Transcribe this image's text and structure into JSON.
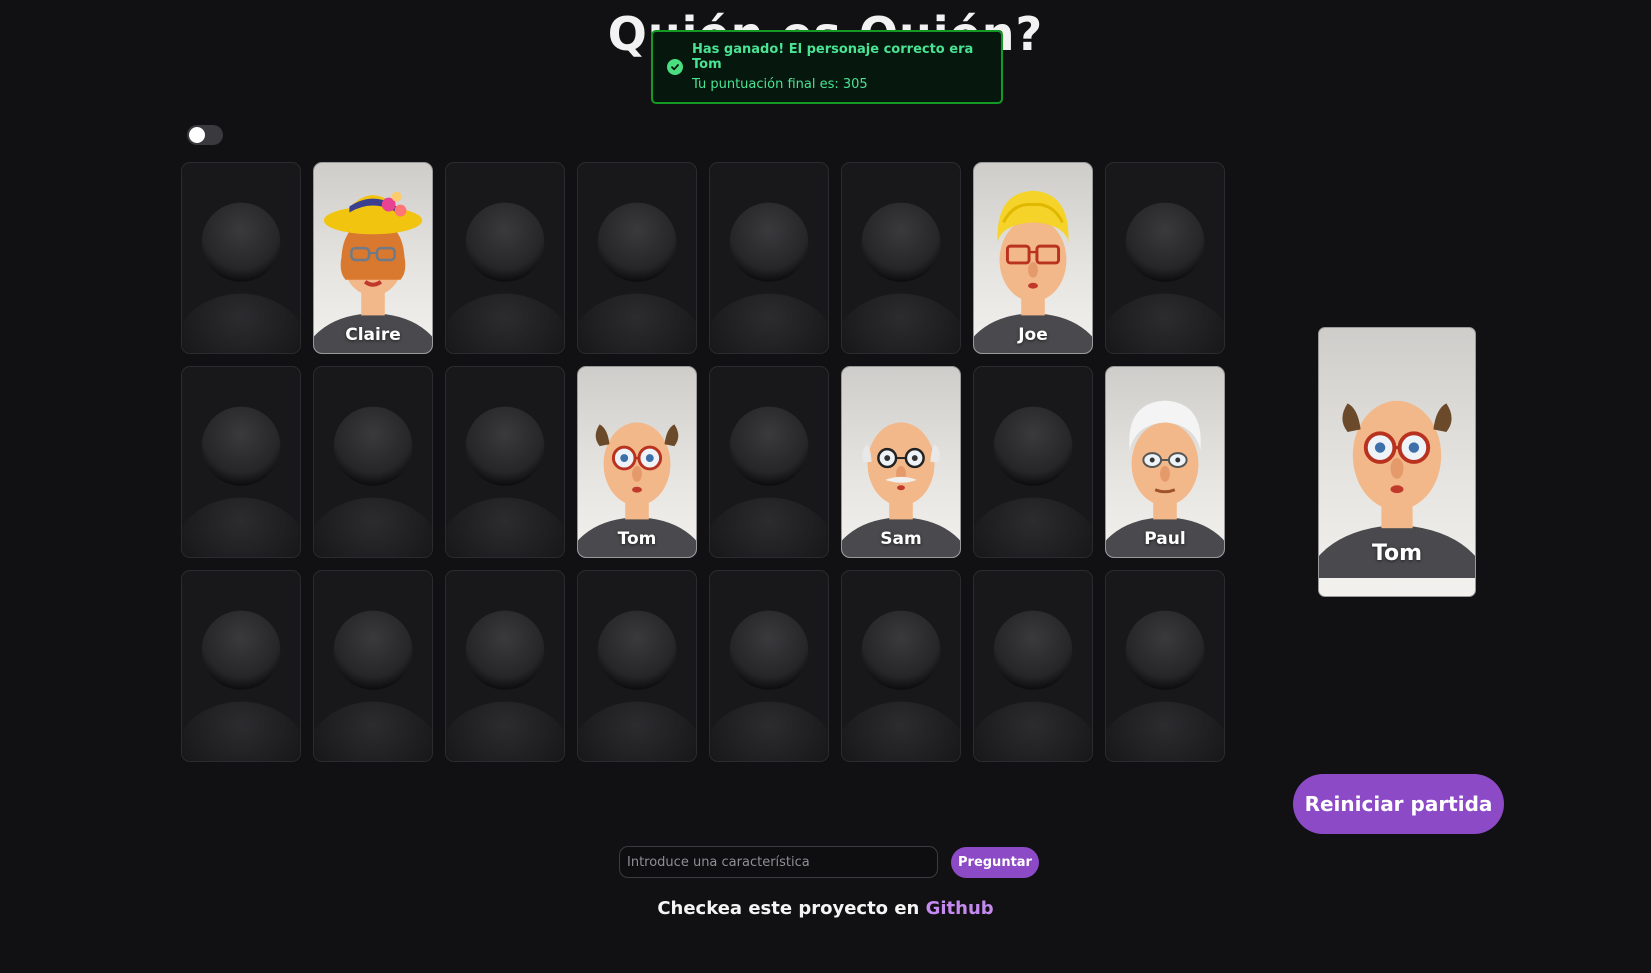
{
  "title": "Quién es Quién?",
  "toast": {
    "title": "Has ganado! El personaje correcto era Tom",
    "description": "Tu puntuación final es: 305",
    "color": "#4ae394"
  },
  "toggle": {
    "state": "off"
  },
  "board": {
    "columns": 8,
    "rows": 3,
    "cards": [
      {
        "name": "",
        "revealed": false
      },
      {
        "name": "Claire",
        "revealed": true,
        "look": "claire"
      },
      {
        "name": "",
        "revealed": false
      },
      {
        "name": "",
        "revealed": false
      },
      {
        "name": "",
        "revealed": false
      },
      {
        "name": "",
        "revealed": false
      },
      {
        "name": "Joe",
        "revealed": true,
        "look": "joe"
      },
      {
        "name": "",
        "revealed": false
      },
      {
        "name": "",
        "revealed": false
      },
      {
        "name": "",
        "revealed": false
      },
      {
        "name": "",
        "revealed": false
      },
      {
        "name": "Tom",
        "revealed": true,
        "look": "tom"
      },
      {
        "name": "",
        "revealed": false
      },
      {
        "name": "Sam",
        "revealed": true,
        "look": "sam"
      },
      {
        "name": "",
        "revealed": false
      },
      {
        "name": "Paul",
        "revealed": true,
        "look": "paul"
      },
      {
        "name": "",
        "revealed": false
      },
      {
        "name": "",
        "revealed": false
      },
      {
        "name": "",
        "revealed": false
      },
      {
        "name": "",
        "revealed": false
      },
      {
        "name": "",
        "revealed": false
      },
      {
        "name": "",
        "revealed": false
      },
      {
        "name": "",
        "revealed": false
      },
      {
        "name": "",
        "revealed": false
      }
    ]
  },
  "secret_card": {
    "name": "Tom",
    "look": "tom"
  },
  "restart_label": "Reiniciar partida",
  "question": {
    "placeholder": "Introduce una característica",
    "value": "",
    "ask_label": "Preguntar"
  },
  "footer": {
    "text": "Checkea este proyecto en ",
    "link_label": "Github"
  },
  "colors": {
    "accent": "#8c4ac6",
    "link": "#c58af0",
    "toast_border": "#139a24",
    "background": "#111113"
  }
}
